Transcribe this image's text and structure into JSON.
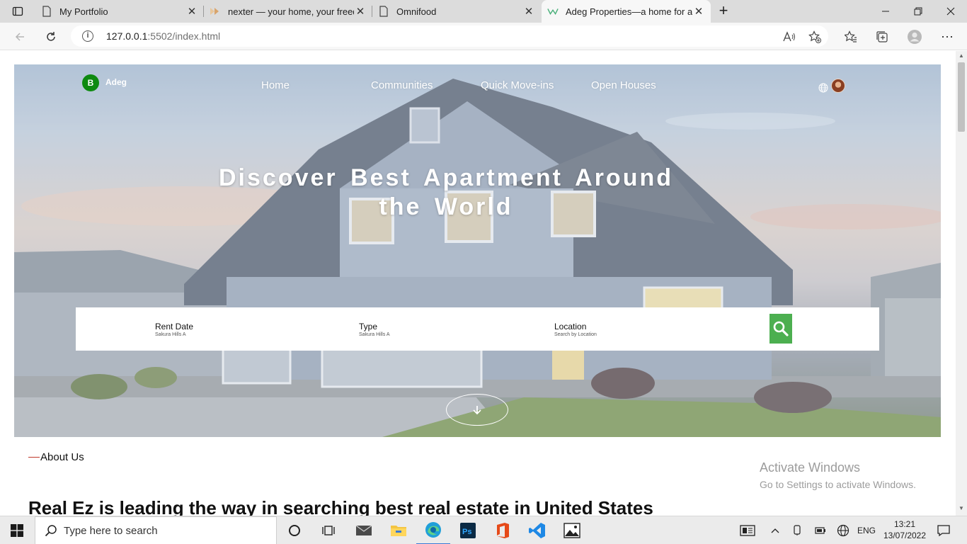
{
  "browser": {
    "tabs": [
      {
        "title": "My Portfolio",
        "favicon": "page-icon",
        "active": false
      },
      {
        "title": "nexter — your home, your freedom",
        "favicon": "nexter-favicon",
        "active": false
      },
      {
        "title": "Omnifood",
        "favicon": "page-icon",
        "active": false
      },
      {
        "title": "Adeg Properties—a home for all",
        "favicon": "adeg-favicon",
        "active": true
      }
    ],
    "url_host": "127.0.0.1",
    "url_rest": ":5502/index.html",
    "url_info_glyph": "i"
  },
  "page": {
    "brand": {
      "initial": "B",
      "name": "Adeg"
    },
    "nav": [
      "Home",
      "Communities",
      "Quick Move-ins",
      "Open Houses"
    ],
    "hero_title_line1": "Discover Best Apartment Around",
    "hero_title_line2": "the World",
    "search": {
      "fields": [
        {
          "label": "Rent Date",
          "sub": "Sakura Hills A"
        },
        {
          "label": "Type",
          "sub": "Sakura Hills A"
        },
        {
          "label": "Location",
          "sub": "Search by Location"
        }
      ],
      "button_color": "#4caf50"
    },
    "about_label": "About Us",
    "about_heading": "Real Ez is leading the way in searching best real estate in United States",
    "watermark": {
      "line1": "Activate Windows",
      "line2": "Go to Settings to activate Windows."
    }
  },
  "taskbar": {
    "search_placeholder": "Type here to search",
    "language": "ENG",
    "time": "13:21",
    "date": "13/07/2022"
  }
}
